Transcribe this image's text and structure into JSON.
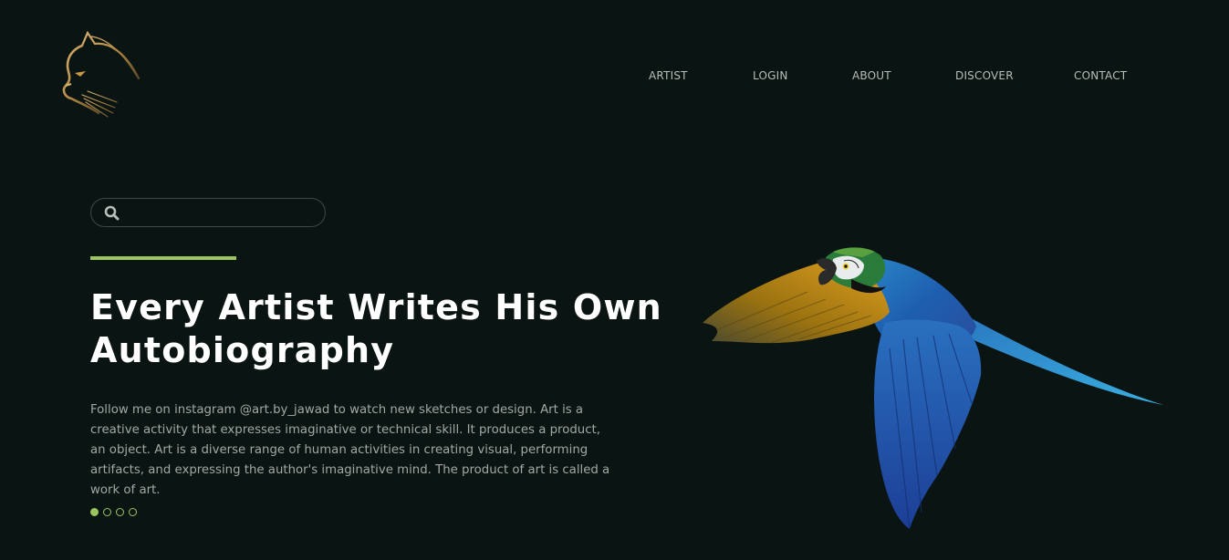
{
  "brand": {
    "logo_icon": "cat-head-icon",
    "accent_color": "#9dc55f"
  },
  "nav": {
    "items": [
      {
        "label": "ARTIST"
      },
      {
        "label": "LOGIN"
      },
      {
        "label": "ABOUT"
      },
      {
        "label": "DISCOVER"
      },
      {
        "label": "CONTACT"
      }
    ]
  },
  "search": {
    "icon": "search-icon",
    "placeholder": "",
    "value": ""
  },
  "hero": {
    "title": "Every Artist Writes His Own Autobiography",
    "description": "Follow me on instagram @art.by_jawad to watch new sketches or design. Art is a creative activity that expresses imaginative or technical skill. It produces a product, an object. Art is a diverse range of human activities in creating visual, performing artifacts, and expressing the author's imaginative mind. The product of art is called a work of art.",
    "image": "flying-macaw-parrot"
  },
  "slider": {
    "count": 4,
    "active_index": 0
  }
}
